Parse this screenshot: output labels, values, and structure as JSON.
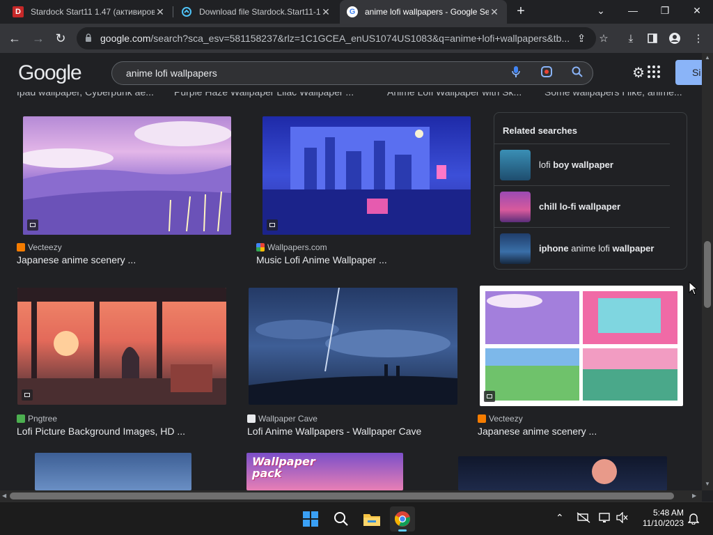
{
  "browser": {
    "tabs": [
      {
        "title": "Stardock Start11 1.47 (активиров",
        "favicon": "D",
        "active": false
      },
      {
        "title": "Download file Stardock.Start11-1",
        "favicon": "",
        "active": false
      },
      {
        "title": "anime lofi wallpapers - Google Se",
        "favicon": "G",
        "active": true
      }
    ],
    "new_tab": "+",
    "address_host": "google.com",
    "address_rest": "/search?sca_esv=581158237&rlz=1C1GCEA_enUS1074US1083&q=anime+lofi+wallpapers&tb...",
    "window_controls": {
      "minimize": "—",
      "restore": "❐",
      "close": "✕",
      "tabsearch": "⌄"
    }
  },
  "google": {
    "logo": "Google",
    "query": "anime lofi wallpapers",
    "sign_in": "Si"
  },
  "top_captions": [
    "Ipad wallpaper, Cyberpunk ae...",
    "Purple Haze Wallpaper Lilac Wallpaper ...",
    "Anime Lofi Wallpaper with Sk...",
    "Some wallpapers I like, anime..."
  ],
  "results": [
    {
      "source": "Vecteezy",
      "title": "Japanese anime scenery ..."
    },
    {
      "source": "Wallpapers.com",
      "title": "Music Lofi Anime Wallpaper ..."
    },
    {
      "source": "Pngtree",
      "title": "Lofi Picture Background Images, HD ..."
    },
    {
      "source": "Wallpaper Cave",
      "title": "Lofi Anime Wallpapers - Wallpaper Cave"
    },
    {
      "source": "Vecteezy",
      "title": "Japanese anime scenery ..."
    }
  ],
  "bottom_thumb_text": "Wallpaper pack",
  "related": {
    "heading": "Related searches",
    "items": [
      {
        "pre": "lofi ",
        "bold": "boy wallpaper",
        "post": ""
      },
      {
        "pre": "",
        "bold": "chill lo-fi wallpaper",
        "post": ""
      },
      {
        "pre": "",
        "bold": "iphone",
        "post": " anime lofi ",
        "bold2": "wallpaper"
      }
    ]
  },
  "taskbar": {
    "time": "5:48 AM",
    "date": "11/10/2023"
  },
  "colors": {
    "accent": "#8ab4f8",
    "background": "#202124",
    "toolbar": "#35363a"
  }
}
